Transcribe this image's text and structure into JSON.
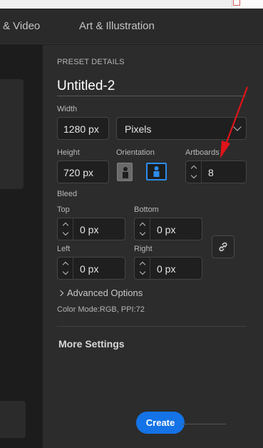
{
  "tabs": [
    {
      "label": "& Video"
    },
    {
      "label": "Art & Illustration"
    }
  ],
  "preset": {
    "section_title": "PRESET DETAILS",
    "doc_name": "Untitled-2",
    "width_label": "Width",
    "width_value": "1280 px",
    "units_value": "Pixels",
    "height_label": "Height",
    "height_value": "720 px",
    "orientation_label": "Orientation",
    "artboards_label": "Artboards",
    "artboards_value": "8",
    "bleed_label": "Bleed",
    "bleed": {
      "top_label": "Top",
      "top_value": "0 px",
      "bottom_label": "Bottom",
      "bottom_value": "0 px",
      "left_label": "Left",
      "left_value": "0 px",
      "right_label": "Right",
      "right_value": "0 px"
    },
    "advanced_label": "Advanced Options",
    "color_mode": "Color Mode:RGB, PPI:72",
    "more_settings": "More Settings",
    "create_label": "Create"
  },
  "colors": {
    "accent": "#1473e6",
    "annotation_arrow": "#e0141a"
  },
  "icons": {
    "portrait": "portrait-orientation-icon",
    "landscape": "landscape-orientation-icon",
    "link": "link-chain-icon",
    "dropdown": "chevron-down-icon",
    "advanced": "chevron-right-icon"
  }
}
